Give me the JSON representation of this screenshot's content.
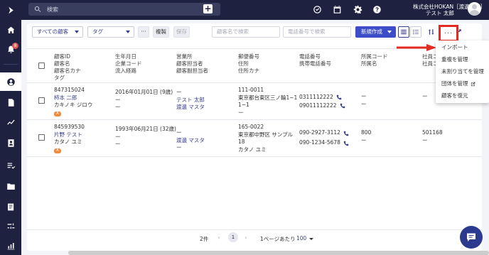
{
  "sidebar": {
    "items": [
      {
        "name": "home",
        "icon": "home-icon"
      },
      {
        "name": "notifications",
        "icon": "bell-icon",
        "badge": "8"
      },
      {
        "name": "customers",
        "icon": "user-circle-icon",
        "active": true
      },
      {
        "name": "documents",
        "icon": "document-icon"
      },
      {
        "name": "analytics",
        "icon": "trend-icon"
      },
      {
        "name": "contacts",
        "icon": "contact-card-icon"
      },
      {
        "name": "tasks",
        "icon": "checklist-icon"
      },
      {
        "name": "folders",
        "icon": "folder-icon"
      },
      {
        "name": "reports",
        "icon": "report-icon"
      },
      {
        "name": "settings-list",
        "icon": "sliders-icon"
      }
    ]
  },
  "topbar": {
    "search_placeholder": "検索",
    "company_name": "株式会社HOKAN［渡邊デモ］",
    "user_name": "テスト 太郎"
  },
  "toolbar": {
    "customer_filter": "すべての顧客",
    "tag_filter": "タグ",
    "more_label": "···",
    "copy_label": "複製",
    "save_label": "保存",
    "customer_name_search": "顧客名で検索",
    "phone_search": "電話番号で検索",
    "new_button": "新規作成",
    "more_menu_label": "···"
  },
  "table": {
    "headers": [
      [
        "顧客ID",
        "顧客名",
        "顧客名カナ",
        "タグ"
      ],
      [
        "生年月日",
        "企業コード",
        "流入経路"
      ],
      [
        "営業所",
        "顧客担当者",
        "顧客副担当者"
      ],
      [
        "郵便番号",
        "住所",
        "住所カナ"
      ],
      [
        "電話番号",
        "携帯電話番号"
      ],
      [
        "所属コード",
        "所属名"
      ],
      [
        "社員コ",
        "社員コ"
      ]
    ],
    "rows": [
      {
        "id": "847315024",
        "name": "柿本 二郎",
        "kana": "カキノキ ジロウ",
        "tag": "A",
        "birthdate": "2016年01月01日 (9歳)",
        "company_code": "ー",
        "inflow": "ー",
        "office": "ー",
        "owner": "テスト 太郎",
        "sub_owner": "渡邊 マスタ",
        "zip": "111-0011",
        "address1": "東京都台東区三ノ輪1−1",
        "address2": "1−1",
        "address_kana": "ー",
        "phone": "0311112222",
        "mobile": "09011112222",
        "affil_code": "ー",
        "affil_name": "ー",
        "emp_code": "ー",
        "emp_code2": ""
      },
      {
        "id": "845939530",
        "name": "片野 テスト",
        "kana": "カタノ ユミ",
        "tag": "A",
        "birthdate": "1993年06月21日 (32歳)",
        "company_code": "ー",
        "inflow": "ー",
        "office": "ー",
        "owner": "渡邊 マスタ",
        "sub_owner": "ー",
        "zip": "165-0022",
        "address1": "東京都中野区 サンプル",
        "address2": "18",
        "address_kana": "カタノ ユミ",
        "phone": "090-2927-3112",
        "mobile": "090-1234-5678",
        "affil_code": "800",
        "affil_name": "ー",
        "emp_code": "501168",
        "emp_code2": "ー"
      }
    ]
  },
  "pagination": {
    "count": "2件",
    "current": "1",
    "per_page_label": "1ページあたり",
    "per_page_value": "100"
  },
  "dropdown_menu": {
    "items": [
      "インポート",
      "重複を管理",
      "未割り当てを管理",
      "団体を管理",
      "顧客を復元"
    ]
  },
  "colors": {
    "sidebar_bg": "#1e2240",
    "primary": "#3d4cc8",
    "link": "#3a3f8f",
    "tag": "#f08a3c",
    "highlight": "#e32b24"
  }
}
